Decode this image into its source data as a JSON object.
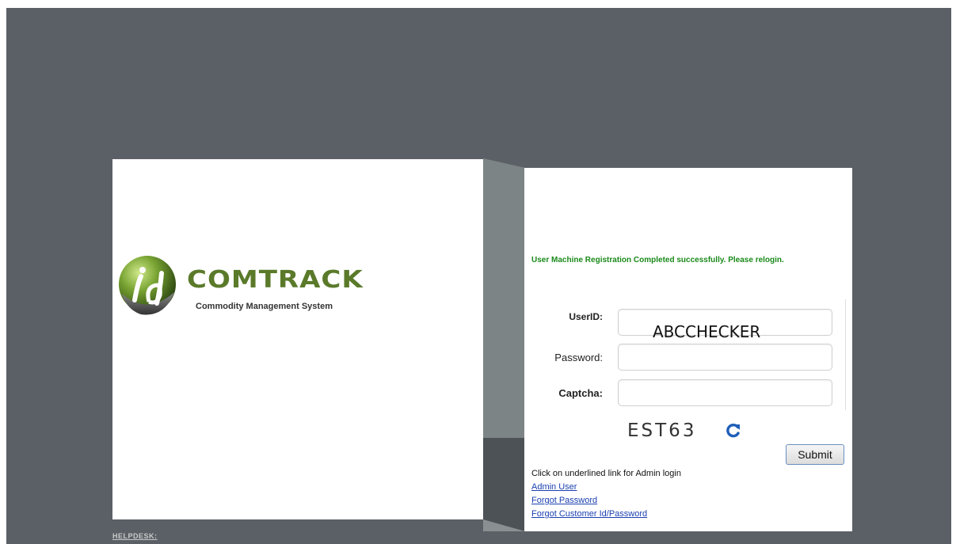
{
  "brand": {
    "name": "COMTRACK",
    "tagline": "Commodity Management System"
  },
  "login": {
    "success_message": "User Machine Registration Completed successfully. Please relogin.",
    "userid_label": "UserID:",
    "userid_value": "ABCCHECKER",
    "password_label": "Password:",
    "password_value": "",
    "captcha_label": "Captcha:",
    "captcha_value": "",
    "captcha_code": "EST63",
    "submit_label": "Submit",
    "admin_note": "Click on underlined link for Admin login",
    "links": {
      "admin_user": "Admin User",
      "forgot_password": "Forgot Password",
      "forgot_customer": "Forgot Customer Id/Password"
    }
  },
  "footer": {
    "helpdesk": "HELPDESK:"
  },
  "colors": {
    "background": "#5b6066",
    "success": "#1a8a1a",
    "link": "#1a3fb0",
    "brand_green": "#5a7a2a"
  },
  "icons": [
    "comtrack-logo-icon",
    "refresh-icon"
  ]
}
